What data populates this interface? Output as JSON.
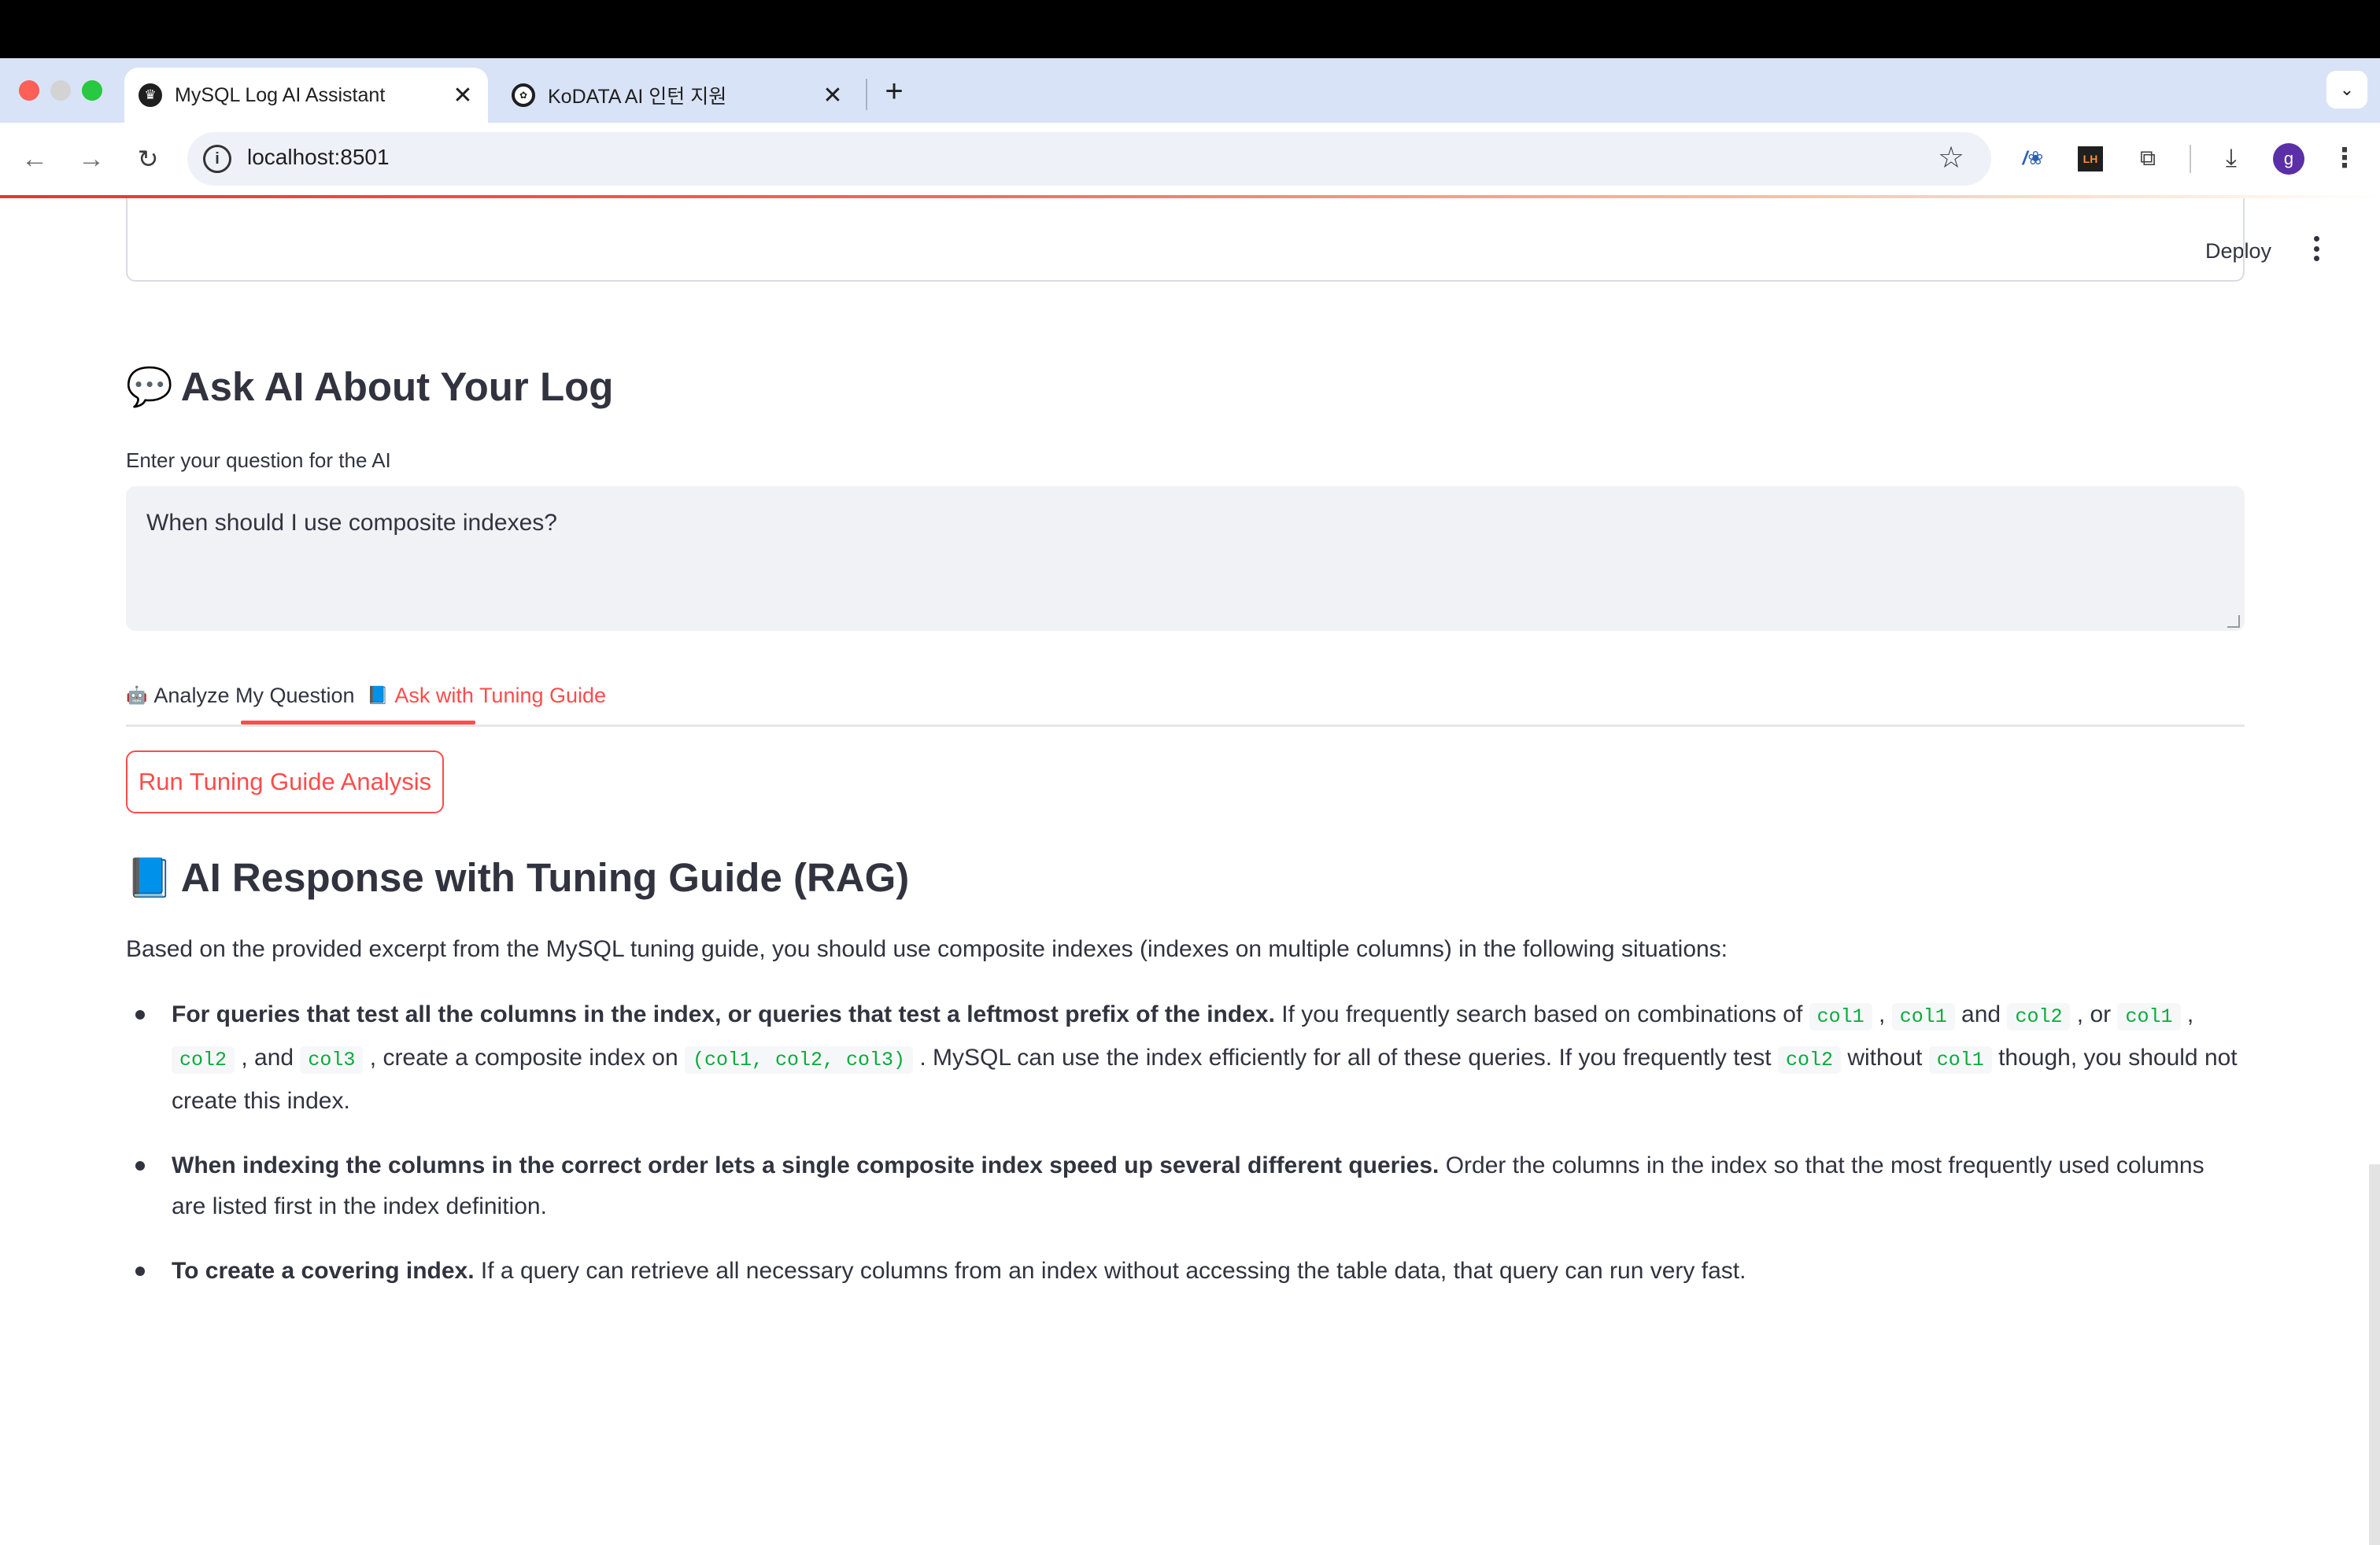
{
  "browser": {
    "tabs": [
      {
        "title": "MySQL Log AI Assistant",
        "active": true,
        "favicon": "streamlit-crown-icon"
      },
      {
        "title": "KoDATA AI 인턴 지원",
        "active": false,
        "favicon": "openai-icon"
      }
    ],
    "url": "localhost:8501",
    "profile_initial": "g",
    "ext_badge": "LH"
  },
  "app": {
    "deploy_label": "Deploy",
    "ask_heading": {
      "emoji": "💬",
      "text": "Ask AI About Your Log"
    },
    "question_label": "Enter your question for the AI",
    "question_value": "When should I use composite indexes?",
    "tabs": [
      {
        "emoji": "🤖",
        "label": "Analyze My Question",
        "active": false
      },
      {
        "emoji": "📘",
        "label": "Ask with Tuning Guide",
        "active": true
      }
    ],
    "run_button": "Run Tuning Guide Analysis",
    "response_heading": {
      "emoji": "📘",
      "text": "AI Response with Tuning Guide (RAG)"
    },
    "response_intro": "Based on the provided excerpt from the MySQL tuning guide, you should use composite indexes (indexes on multiple columns) in the following situations:",
    "bullets": [
      {
        "bold": "For queries that test all the columns in the index, or queries that test a leftmost prefix of the index.",
        "parts": [
          {
            "t": " If you frequently search based on combinations of "
          },
          {
            "c": "col1"
          },
          {
            "t": " , "
          },
          {
            "c": "col1"
          },
          {
            "t": " and "
          },
          {
            "c": "col2"
          },
          {
            "t": " , or "
          },
          {
            "c": "col1"
          },
          {
            "t": " , "
          },
          {
            "c": "col2"
          },
          {
            "t": " , and "
          },
          {
            "c": "col3"
          },
          {
            "t": " , create a composite index on "
          },
          {
            "c": "(col1, col2, col3)"
          },
          {
            "t": " . MySQL can use the index efficiently for all of these queries. If you frequently test "
          },
          {
            "c": "col2"
          },
          {
            "t": " without "
          },
          {
            "c": "col1"
          },
          {
            "t": " though, you should not create this index."
          }
        ]
      },
      {
        "bold": "When indexing the columns in the correct order lets a single composite index speed up several different queries.",
        "parts": [
          {
            "t": " Order the columns in the index so that the most frequently used columns are listed first in the index definition."
          }
        ]
      },
      {
        "bold": "To create a covering index.",
        "parts": [
          {
            "t": " If a query can retrieve all necessary columns from an index without accessing the table data, that query can run very fast."
          }
        ]
      }
    ]
  },
  "colors": {
    "accent": "#ff4b4b",
    "code": "#09ab3b",
    "text": "#31333f",
    "input_bg": "#f0f2f6"
  }
}
